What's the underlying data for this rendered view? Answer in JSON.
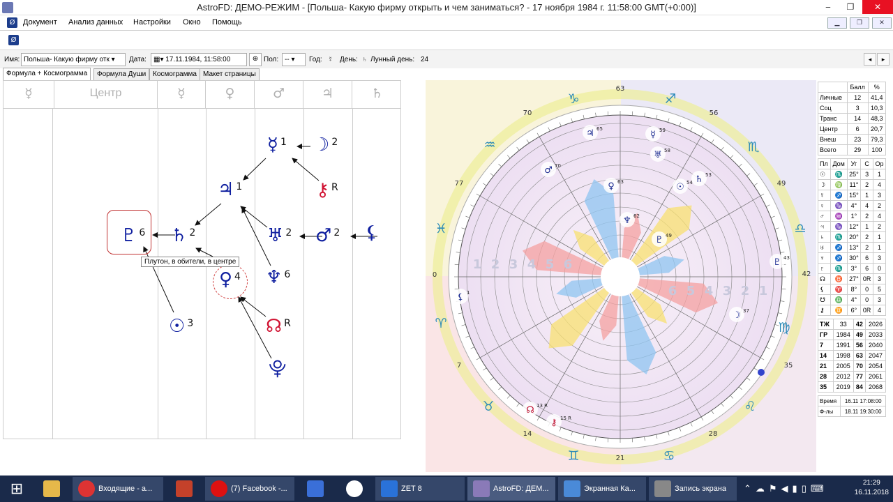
{
  "window": {
    "title": "AstroFD: ДЕМО-РЕЖИМ - [Польша- Какую фирму открыть и чем заниматься? - 17 ноября 1984 г. 11:58:00 GMT(+0:00)]",
    "min": "‒",
    "max": "❐",
    "close": "✕"
  },
  "menu": [
    "Документ",
    "Анализ данных",
    "Настройки",
    "Окно",
    "Помощь"
  ],
  "params": {
    "name_label": "Имя:",
    "name_value": "Польша- Какую фирму отк",
    "date_label": "Дата:",
    "date_value": "17.11.1984, 11:58:00",
    "sex_label": "Пол:",
    "sex_value": "--",
    "year_label": "Год:",
    "year_icon": "☿",
    "day_label": "День:",
    "day_icon": "♄",
    "lunar_label": "Лунный день:",
    "lunar_value": "24"
  },
  "tabs": [
    "Формула + Космограмма",
    "Формула Души",
    "Космограмма",
    "Макет страницы"
  ],
  "columns": [
    "☿",
    "Центр",
    "☿",
    "♀",
    "♂",
    "♃",
    "♄"
  ],
  "formula": {
    "mercury": {
      "g": "☿",
      "n": "1"
    },
    "moon": {
      "g": "☽",
      "n": "2"
    },
    "jupiter": {
      "g": "♃",
      "n": "1"
    },
    "chiron": {
      "g": "⚷",
      "n": "R"
    },
    "pluto": {
      "g": "♇",
      "n": "6"
    },
    "saturn": {
      "g": "♄",
      "n": "2"
    },
    "uranus": {
      "g": "♅",
      "n": "2"
    },
    "mars": {
      "g": "♂",
      "n": "2"
    },
    "lilith": {
      "g": "⚸",
      "n": ""
    },
    "neptune": {
      "g": "♆",
      "n": "6"
    },
    "venus": {
      "g": "♀",
      "n": "4"
    },
    "sun": {
      "g": "☉",
      "n": "3"
    },
    "node": {
      "g": "☊",
      "n": "R"
    },
    "proserpina": {
      "g": "⯓",
      "n": ""
    }
  },
  "tooltip": "Плутон, в обители, в центре",
  "chart": {
    "degree_labels": [
      "63",
      "56",
      "49",
      "42",
      "35",
      "28",
      "21",
      "14",
      "7",
      "0",
      "77",
      "70"
    ],
    "zodiac": [
      "♑",
      "♐",
      "♏",
      "♎",
      "♍",
      "♌",
      "♋",
      "♊",
      "♉",
      "♈",
      "♓",
      "♒"
    ],
    "ring_numbers": [
      "1",
      "2",
      "3",
      "4",
      "5",
      "6"
    ],
    "planets": [
      {
        "g": "♃",
        "n": "65"
      },
      {
        "g": "☿",
        "n": "59"
      },
      {
        "g": "♅",
        "n": "58"
      },
      {
        "g": "♂",
        "n": "70"
      },
      {
        "g": "♀",
        "n": "63"
      },
      {
        "g": "☉",
        "n": "54"
      },
      {
        "g": "♄",
        "n": "53"
      },
      {
        "g": "♆",
        "n": "62"
      },
      {
        "g": "♇",
        "n": "49"
      },
      {
        "g": "♇",
        "n": "43"
      },
      {
        "g": "⚸",
        "n": "1"
      },
      {
        "g": "☽",
        "n": "37"
      },
      {
        "g": "☊",
        "n": "13 R"
      },
      {
        "g": "⚷",
        "n": "15 R"
      }
    ]
  },
  "stats_head": [
    "",
    "Балл",
    "%"
  ],
  "stats": [
    [
      "Личные",
      "12",
      "41,4"
    ],
    [
      "Соц",
      "3",
      "10,3"
    ],
    [
      "Транс",
      "14",
      "48,3"
    ],
    [
      "Центр",
      "6",
      "20,7"
    ],
    [
      "Внеш",
      "23",
      "79,3"
    ],
    [
      "Всего",
      "29",
      "100"
    ]
  ],
  "pos_head": [
    "Пл",
    "Дом",
    "Уг",
    "С",
    "Ор"
  ],
  "positions": [
    [
      "☉",
      "♏",
      "25°",
      "3",
      "1"
    ],
    [
      "☽",
      "♍",
      "11°",
      "2",
      "4"
    ],
    [
      "☿",
      "♐",
      "15°",
      "1",
      "3"
    ],
    [
      "♀",
      "♑",
      "4°",
      "4",
      "2"
    ],
    [
      "♂",
      "♒",
      "1°",
      "2",
      "4"
    ],
    [
      "♃",
      "♑",
      "12°",
      "1",
      "2"
    ],
    [
      "♄",
      "♏",
      "20°",
      "2",
      "1"
    ],
    [
      "♅",
      "♐",
      "13°",
      "2",
      "1"
    ],
    [
      "♆",
      "♐",
      "30°",
      "6",
      "3"
    ],
    [
      "♇",
      "♏",
      "3°",
      "6",
      "0"
    ],
    [
      "☊",
      "♉",
      "27°",
      "0R",
      "3"
    ],
    [
      "⚸",
      "♈",
      "8°",
      "0",
      "5"
    ],
    [
      "☋",
      "♎",
      "4°",
      "0",
      "3"
    ],
    [
      "⚷",
      "♊",
      "6°",
      "0R",
      "4"
    ]
  ],
  "cycles": [
    [
      "ТЖ",
      "33",
      "42",
      "2026"
    ],
    [
      "ГР",
      "1984",
      "49",
      "2033"
    ],
    [
      "7",
      "1991",
      "56",
      "2040"
    ],
    [
      "14",
      "1998",
      "63",
      "2047"
    ],
    [
      "21",
      "2005",
      "70",
      "2054"
    ],
    [
      "28",
      "2012",
      "77",
      "2061"
    ],
    [
      "35",
      "2019",
      "84",
      "2068"
    ]
  ],
  "times": [
    [
      "Время",
      "16.11 17:08:00"
    ],
    [
      "Ф-лы",
      "18.11 19:30:00"
    ]
  ],
  "taskbar": [
    "Входящие - а...",
    "(7) Facebook -...",
    "ZET 8",
    "AstroFD: ДЕМ...",
    "Экранная Ка...",
    "Запись экрана"
  ],
  "clock": {
    "time": "21:29",
    "date": "16.11.2018"
  }
}
